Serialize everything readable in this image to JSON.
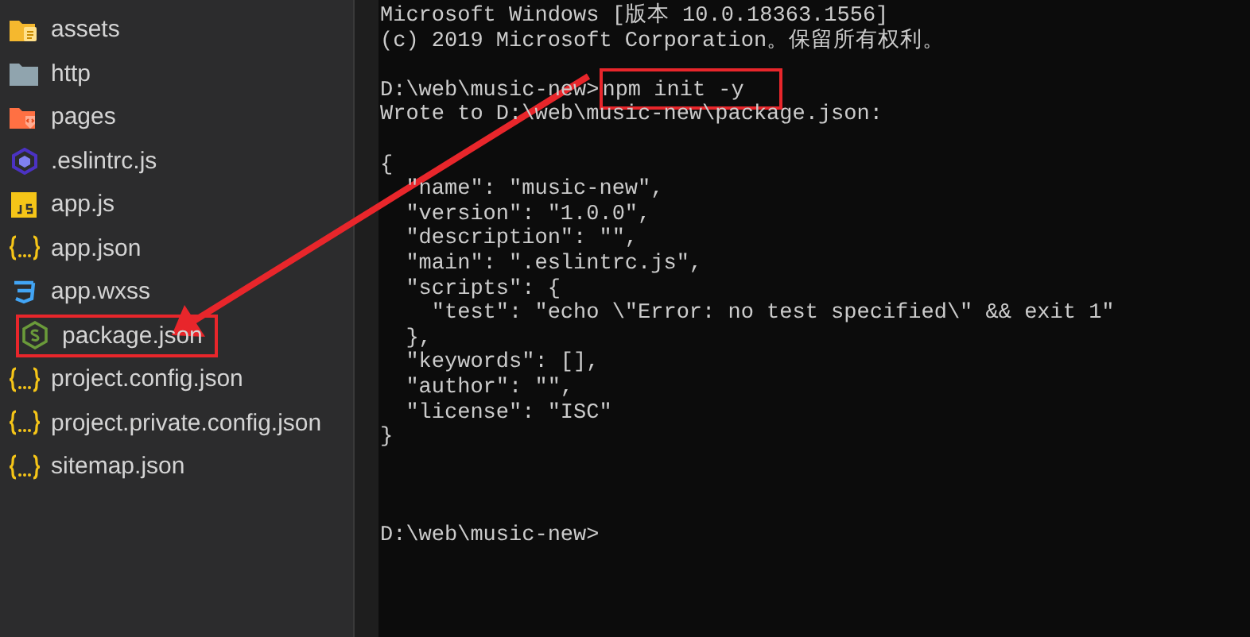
{
  "explorer": {
    "items": [
      {
        "name": "assets",
        "kind": "assets-folder",
        "highlighted": false
      },
      {
        "name": "http",
        "kind": "folder",
        "highlighted": false
      },
      {
        "name": "pages",
        "kind": "pages-folder",
        "highlighted": false
      },
      {
        "name": ".eslintrc.js",
        "kind": "eslint",
        "highlighted": false
      },
      {
        "name": "app.js",
        "kind": "js",
        "highlighted": false
      },
      {
        "name": "app.json",
        "kind": "json",
        "highlighted": false
      },
      {
        "name": "app.wxss",
        "kind": "css",
        "highlighted": false
      },
      {
        "name": "package.json",
        "kind": "node",
        "highlighted": true
      },
      {
        "name": "project.config.json",
        "kind": "json",
        "highlighted": false
      },
      {
        "name": "project.private.config.json",
        "kind": "json",
        "highlighted": false
      },
      {
        "name": "sitemap.json",
        "kind": "json",
        "highlighted": false
      }
    ]
  },
  "terminal": {
    "lines": [
      {
        "kind": "output",
        "text": "Microsoft Windows [版本 10.0.18363.1556]"
      },
      {
        "kind": "output",
        "text": "(c) 2019 Microsoft Corporation。保留所有权利。"
      },
      {
        "kind": "blank"
      },
      {
        "kind": "prompt",
        "prompt": "D:\\web\\music-new>",
        "command": "npm init -y",
        "highlighted": true
      },
      {
        "kind": "output",
        "text": "Wrote to D:\\web\\music-new\\package.json:"
      },
      {
        "kind": "blank"
      },
      {
        "kind": "output",
        "text": "{"
      },
      {
        "kind": "output",
        "text": "  \"name\": \"music-new\","
      },
      {
        "kind": "output",
        "text": "  \"version\": \"1.0.0\","
      },
      {
        "kind": "output",
        "text": "  \"description\": \"\","
      },
      {
        "kind": "output",
        "text": "  \"main\": \".eslintrc.js\","
      },
      {
        "kind": "output",
        "text": "  \"scripts\": {"
      },
      {
        "kind": "output",
        "text": "    \"test\": \"echo \\\"Error: no test specified\\\" && exit 1\""
      },
      {
        "kind": "output",
        "text": "  },"
      },
      {
        "kind": "output",
        "text": "  \"keywords\": [],"
      },
      {
        "kind": "output",
        "text": "  \"author\": \"\","
      },
      {
        "kind": "output",
        "text": "  \"license\": \"ISC\""
      },
      {
        "kind": "output",
        "text": "}"
      },
      {
        "kind": "blank"
      },
      {
        "kind": "blank"
      },
      {
        "kind": "blank"
      },
      {
        "kind": "prompt",
        "prompt": "D:\\web\\music-new>",
        "highlighted": false
      }
    ]
  }
}
